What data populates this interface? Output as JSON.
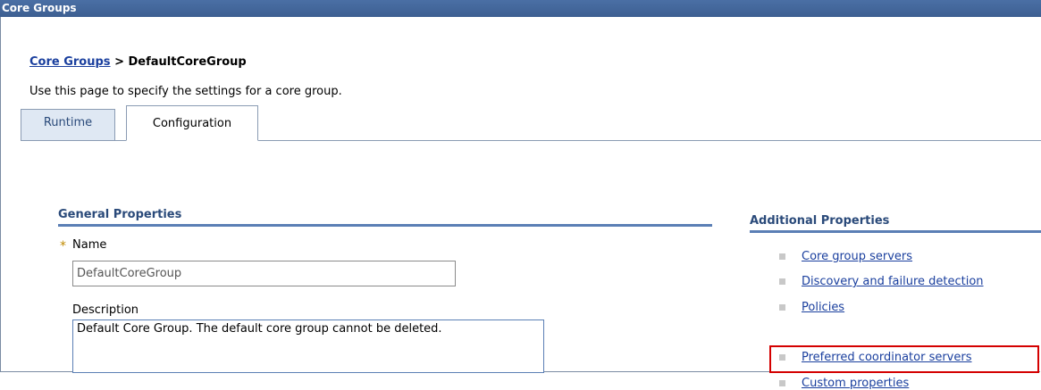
{
  "window": {
    "title": "Core Groups"
  },
  "breadcrumb": {
    "link": "Core Groups",
    "separator": " > ",
    "current": "DefaultCoreGroup"
  },
  "page": {
    "description": "Use this page to specify the settings for a core group."
  },
  "tabs": [
    {
      "label": "Runtime",
      "active": false
    },
    {
      "label": "Configuration",
      "active": true
    }
  ],
  "general_properties": {
    "title": "General Properties",
    "required_marker": "*",
    "name_label": "Name",
    "name_value": "DefaultCoreGroup",
    "description_label": "Description",
    "description_value": "Default Core Group. The default core group cannot be deleted."
  },
  "additional_properties": {
    "title": "Additional Properties",
    "items": [
      {
        "label": "Core group servers"
      },
      {
        "label": "Discovery and failure detection"
      },
      {
        "label": "Policies"
      },
      {
        "label": "Preferred coordinator servers",
        "highlighted": true
      },
      {
        "label": "Custom properties"
      }
    ]
  },
  "colors": {
    "title_bar": "#4a6fa5",
    "link": "#1a3f9e",
    "highlight_box": "#d40000"
  }
}
